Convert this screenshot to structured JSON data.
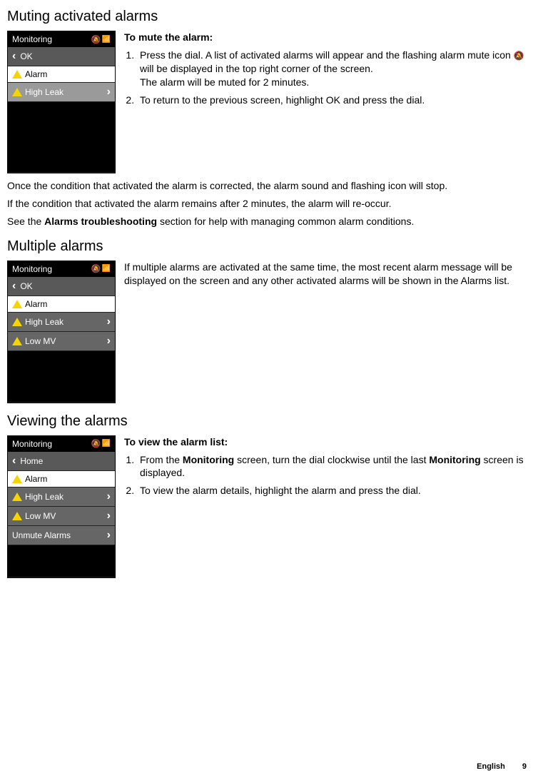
{
  "headings": {
    "muting": "Muting activated alarms",
    "multiple": "Multiple alarms",
    "viewing": "Viewing the alarms"
  },
  "screens": {
    "mute": {
      "title": "Monitoring",
      "ok": "OK",
      "alarm": "Alarm",
      "highLeak": "High Leak"
    },
    "multi": {
      "title": "Monitoring",
      "ok": "OK",
      "alarm": "Alarm",
      "highLeak": "High Leak",
      "lowMV": "Low MV"
    },
    "view": {
      "title": "Monitoring",
      "home": "Home",
      "alarm": "Alarm",
      "highLeak": "High Leak",
      "lowMV": "Low MV",
      "unmute": "Unmute Alarms"
    }
  },
  "text": {
    "toMute": "To mute the alarm:",
    "mute1a": "Press the dial. A list of activated alarms will appear and the flashing alarm mute icon ",
    "mute1b": " will be displayed in the top right corner of the screen.",
    "mute1c": "The alarm will be muted for 2 minutes.",
    "mute2": "To return to the previous screen, highlight OK and press the dial.",
    "afterCorrected": "Once the condition that activated the alarm is corrected, the alarm sound and flashing icon will stop.",
    "remains": "If the condition that activated the alarm remains after 2 minutes, the alarm will re-occur.",
    "seePre": "See the ",
    "seeBold": "Alarms troubleshooting",
    "seePost": " section for help with managing common alarm conditions.",
    "multiText": "If multiple alarms are activated at the same time, the most recent alarm message will be displayed on the screen and any other activated alarms will be shown in the Alarms list.",
    "toView": "To view the alarm list:",
    "view1a": "From the ",
    "view1b": "Monitoring",
    "view1c": " screen, turn the dial clockwise until the last ",
    "view1d": "Monitoring",
    "view1e": " screen is displayed.",
    "view2": "To view the alarm details, highlight the alarm and press the dial."
  },
  "footer": {
    "lang": "English",
    "page": "9"
  }
}
